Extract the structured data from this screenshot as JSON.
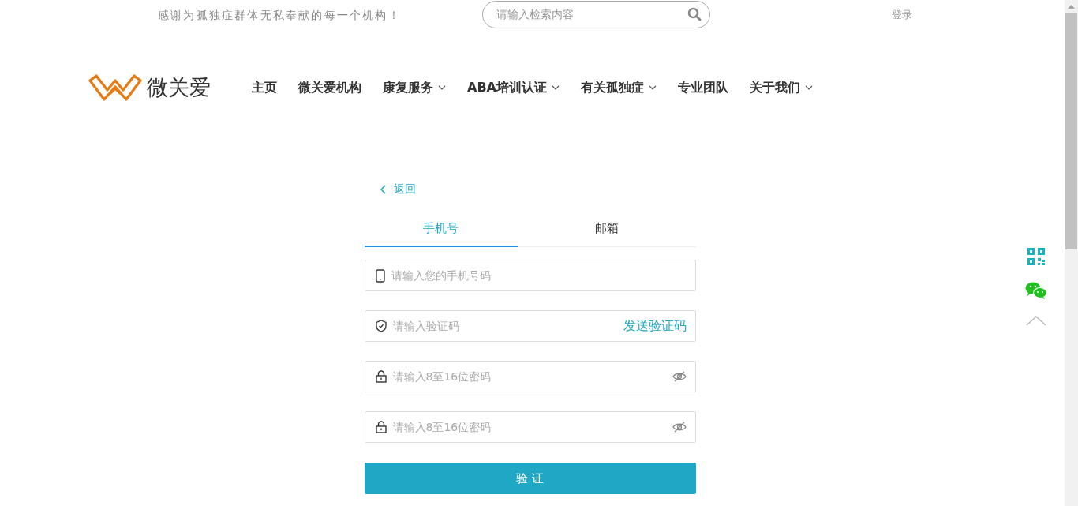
{
  "header": {
    "slogan": "感谢为孤独症群体无私奉献的每一个机构！",
    "search": {
      "placeholder": "请输入检索内容"
    },
    "login": "登录"
  },
  "logo": {
    "text": "微关爱"
  },
  "nav": [
    {
      "label": "主页",
      "kind": "link"
    },
    {
      "label": "微关爱机构",
      "kind": "link"
    },
    {
      "label": "康复服务",
      "kind": "dropdown"
    },
    {
      "label": "ABA培训认证",
      "kind": "dropdown"
    },
    {
      "label": "有关孤独症",
      "kind": "dropdown"
    },
    {
      "label": "专业团队",
      "kind": "link"
    },
    {
      "label": "关于我们",
      "kind": "dropdown"
    }
  ],
  "form": {
    "back": "返回",
    "tabs": [
      {
        "label": "手机号",
        "selected": true
      },
      {
        "label": "邮箱",
        "selected": false
      }
    ],
    "fields": [
      {
        "kind": "phone",
        "placeholder": "请输入您的手机号码"
      },
      {
        "kind": "code",
        "placeholder": "请输入验证码",
        "action": "发送验证码"
      },
      {
        "kind": "password",
        "placeholder": "请输入8至16位密码"
      },
      {
        "kind": "password",
        "placeholder": "请输入8至16位密码"
      }
    ],
    "submit": "验 证"
  }
}
